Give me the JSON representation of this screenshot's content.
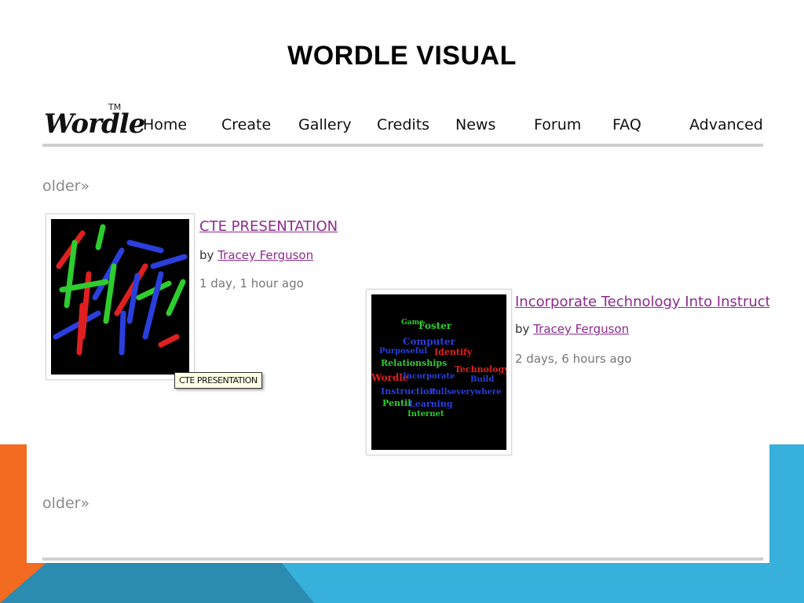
{
  "slide": {
    "title": "WORDLE VISUAL"
  },
  "app": {
    "logo": "Wordle",
    "logo_tm": "TM",
    "nav": [
      "Home",
      "Create",
      "Gallery",
      "Credits",
      "News",
      "Forum",
      "FAQ",
      "Advanced"
    ]
  },
  "gallery": {
    "older_top": "older»",
    "older_bottom": "older»",
    "entries": [
      {
        "title": "CTE PRESENTATION",
        "by_prefix": "by",
        "author": "Tracey Ferguson",
        "time": "1 day, 1 hour ago",
        "tooltip": "CTE PRESENTATION"
      },
      {
        "title": "Incorporate Technology Into Instruction",
        "by_prefix": "by",
        "author": "Tracey Ferguson",
        "time": "2 days, 6 hours ago"
      }
    ]
  },
  "word_cloud_2": {
    "words": [
      {
        "text": "Game",
        "color": "#2ecc2e"
      },
      {
        "text": "Foster",
        "color": "#2ecc2e"
      },
      {
        "text": "Computer",
        "color": "#2a3fdc"
      },
      {
        "text": "Purposeful",
        "color": "#2a3fdc"
      },
      {
        "text": "Identify",
        "color": "#e02020"
      },
      {
        "text": "Relationships",
        "color": "#2ecc2e"
      },
      {
        "text": "Technology",
        "color": "#e02020"
      },
      {
        "text": "Wordle",
        "color": "#e02020"
      },
      {
        "text": "Incorporate",
        "color": "#2a3fdc"
      },
      {
        "text": "Build",
        "color": "#2a3fdc"
      },
      {
        "text": "Instruction",
        "color": "#2a3fdc"
      },
      {
        "text": "Pullseverywhere",
        "color": "#2a3fdc"
      },
      {
        "text": "Pentil",
        "color": "#2ecc2e"
      },
      {
        "text": "Learning",
        "color": "#2a3fdc"
      },
      {
        "text": "Internet",
        "color": "#2ecc2e"
      }
    ]
  },
  "colors": {
    "accent_orange": "#f26b21",
    "accent_blue": "#37b0dc",
    "link_purple": "#8e2a8e"
  }
}
